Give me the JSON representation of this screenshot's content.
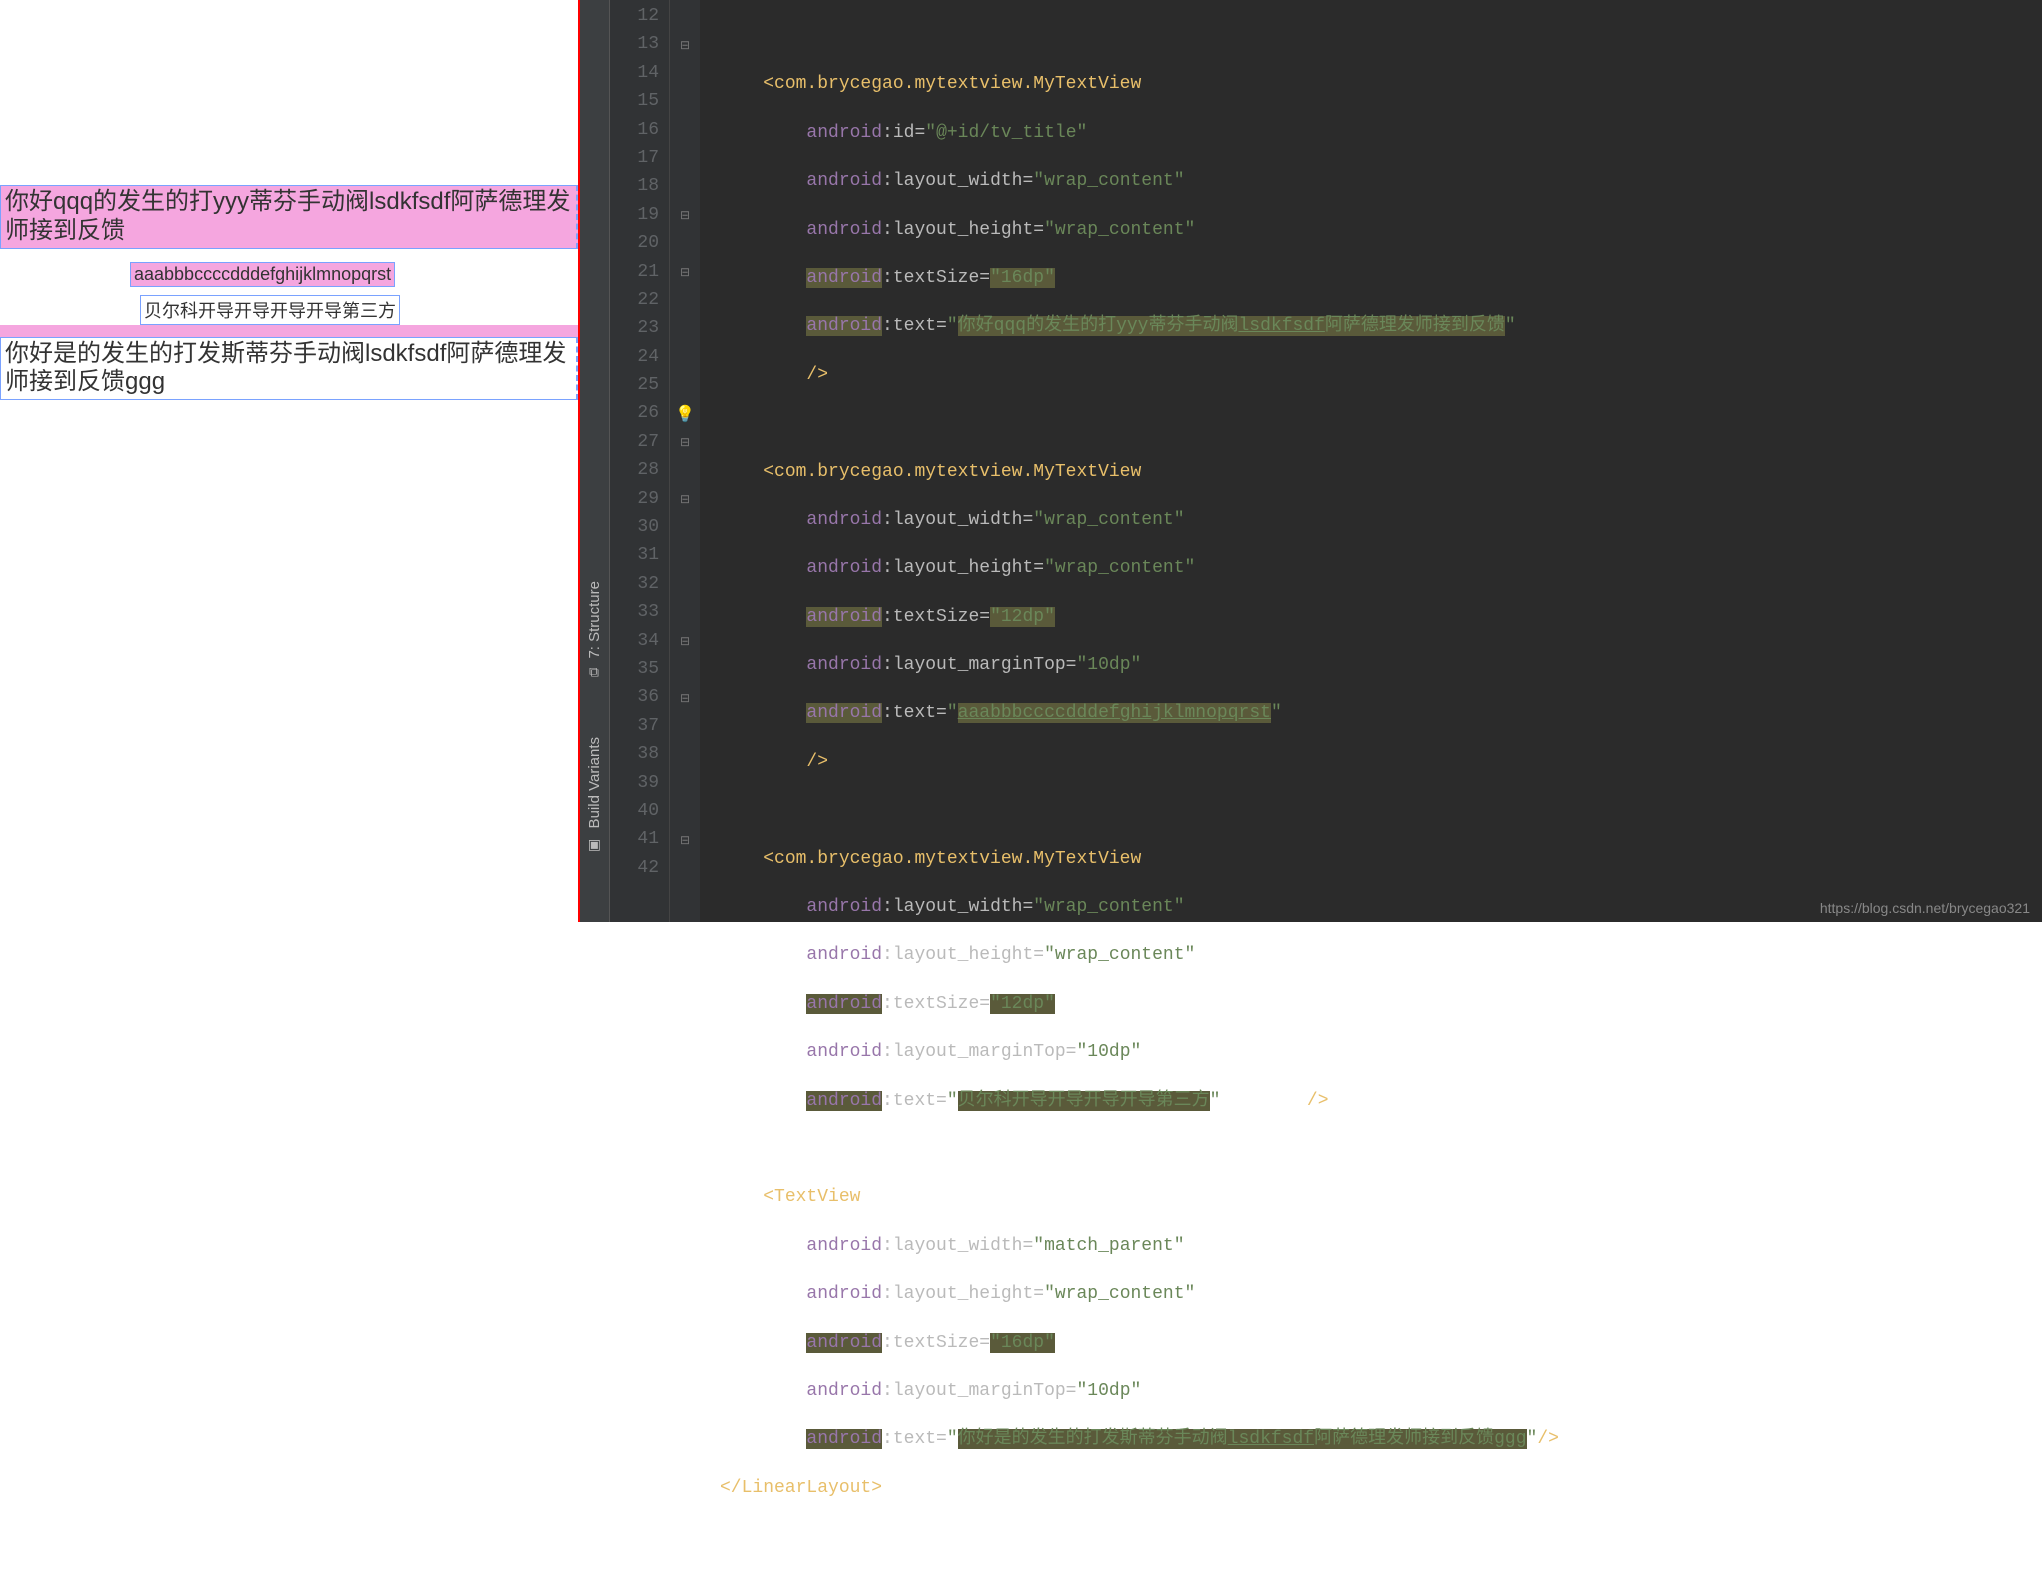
{
  "preview": {
    "tv1": "你好qqq的发生的打yyy蒂芬手动阀lsdkfsdf阿萨德理发师接到反馈",
    "tv2": "aaabbbccccdddefghijklmnopqrst",
    "tv3": "贝尔科开导开导开导开导第三方",
    "tv4": "你好是的发生的打发斯蒂芬手动阀lsdkfsdf阿萨德理发师接到反馈ggg"
  },
  "sideTabs": {
    "structure": "7: Structure",
    "build": "Build Variants"
  },
  "lineNumbers": [
    "12",
    "13",
    "14",
    "15",
    "16",
    "17",
    "18",
    "19",
    "20",
    "21",
    "22",
    "23",
    "24",
    "25",
    "26",
    "27",
    "28",
    "29",
    "30",
    "31",
    "32",
    "33",
    "34",
    "35",
    "36",
    "37",
    "38",
    "39",
    "40",
    "41",
    "42"
  ],
  "code": {
    "l13": {
      "tag": "<com.brycegao.mytextview.MyTextView"
    },
    "l14": {
      "ns": "android",
      "attr": ":id=",
      "val": "\"@+id/tv_title\""
    },
    "l15": {
      "ns": "android",
      "attr": ":layout_width=",
      "val": "\"wrap_content\""
    },
    "l16": {
      "ns": "android",
      "attr": ":layout_height=",
      "val": "\"wrap_content\""
    },
    "l17": {
      "ns": "android",
      "attr": ":textSize=",
      "val": "\"16dp\""
    },
    "l18": {
      "ns": "android",
      "attr": ":text=",
      "q1": "\"",
      "v1": "你好qqq的发生的打yyy蒂芬手动阀",
      "vu": "lsdkfsdf",
      "v2": "阿萨德理发师接到反馈",
      "q2": "\""
    },
    "l19": {
      "close": "/>"
    },
    "l21": {
      "tag": "<com.brycegao.mytextview.MyTextView"
    },
    "l22": {
      "ns": "android",
      "attr": ":layout_width=",
      "val": "\"wrap_content\""
    },
    "l23": {
      "ns": "android",
      "attr": ":layout_height=",
      "val": "\"wrap_content\""
    },
    "l24": {
      "ns": "android",
      "attr": ":textSize=",
      "val": "\"12dp\""
    },
    "l25": {
      "ns": "android",
      "attr": ":layout_marginTop=",
      "val": "\"10dp\""
    },
    "l26": {
      "ns": "android",
      "attr": ":text=",
      "q1": "\"",
      "vu": "aaabbbccccdddefghijklmnopqrst",
      "q2": "\""
    },
    "l27": {
      "close": "/>"
    },
    "l29": {
      "tag": "<com.brycegao.mytextview.MyTextView"
    },
    "l30": {
      "ns": "android",
      "attr": ":layout_width=",
      "val": "\"wrap_content\""
    },
    "l31": {
      "ns": "android",
      "attr": ":layout_height=",
      "val": "\"wrap_content\""
    },
    "l32": {
      "ns": "android",
      "attr": ":textSize=",
      "val": "\"12dp\""
    },
    "l33": {
      "ns": "android",
      "attr": ":layout_marginTop=",
      "val": "\"10dp\""
    },
    "l34": {
      "ns": "android",
      "attr": ":text=",
      "q1": "\"",
      "v1": "贝尔科开导开导开导开导第三方",
      "q2": "\"",
      "close": "/>"
    },
    "l36": {
      "tag": "<TextView"
    },
    "l37": {
      "ns": "android",
      "attr": ":layout_width=",
      "val": "\"match_parent\""
    },
    "l38": {
      "ns": "android",
      "attr": ":layout_height=",
      "val": "\"wrap_content\""
    },
    "l39": {
      "ns": "android",
      "attr": ":textSize=",
      "val": "\"16dp\""
    },
    "l40": {
      "ns": "android",
      "attr": ":layout_marginTop=",
      "val": "\"10dp\""
    },
    "l41": {
      "ns": "android",
      "attr": ":text=",
      "q1": "\"",
      "v1": "你好是的发生的打发斯蒂芬手动阀",
      "vu": "lsdkfsdf",
      "v2": "阿萨德理发师接到反馈",
      "v3": "ggg",
      "q2": "\"",
      "close": "/>"
    },
    "l42": {
      "closeTag": "</LinearLayout>"
    }
  },
  "watermark": "https://blog.csdn.net/brycegao321"
}
